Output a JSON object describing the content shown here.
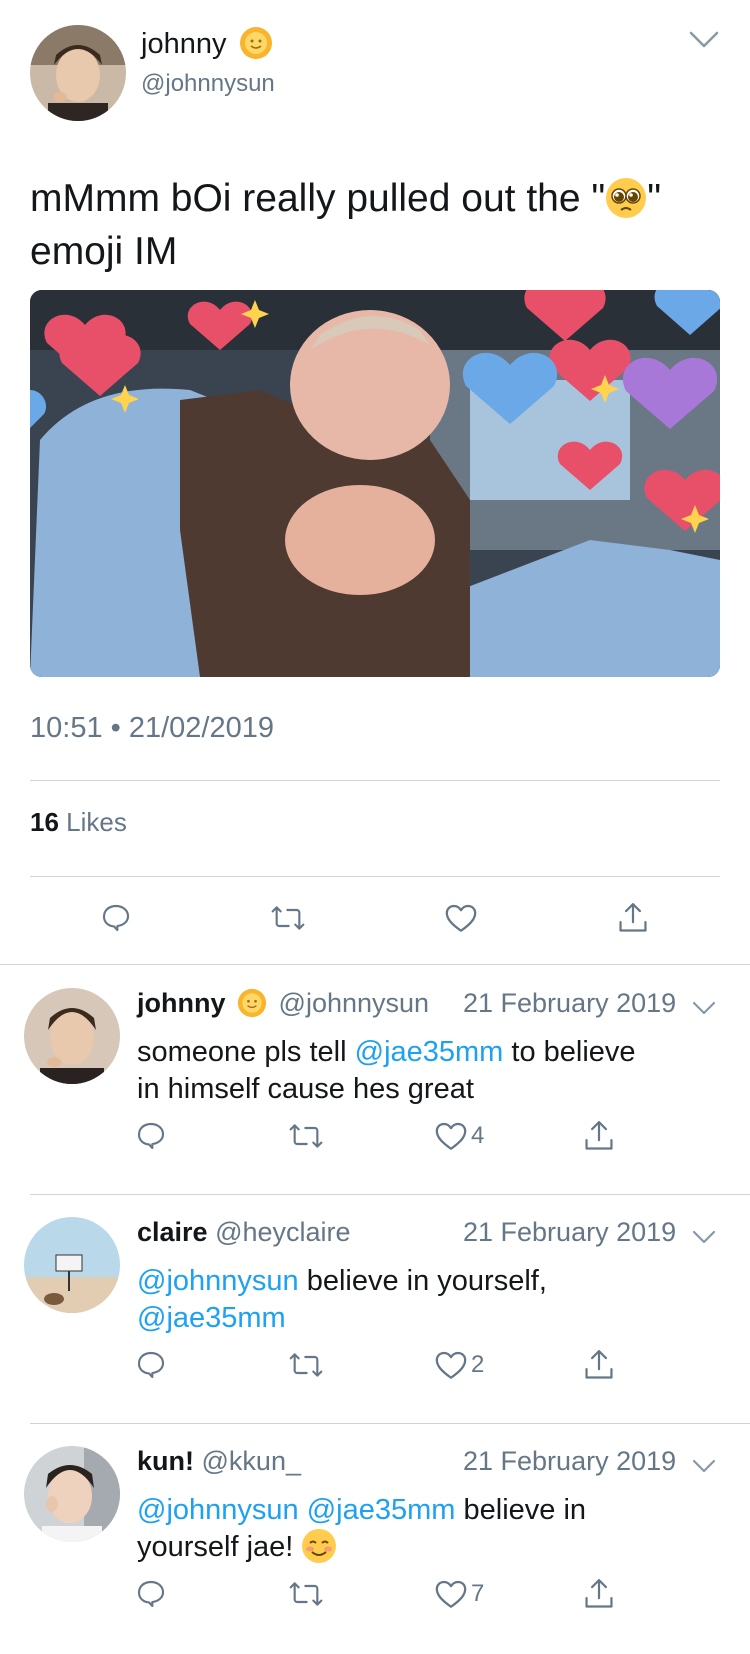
{
  "main_tweet": {
    "author_name": "johnny",
    "author_emoji": "sun-with-face",
    "handle": "@johnnysun",
    "text_before_emoji": "mMmm bOi really pulled out the \"",
    "text_emoji": "pleading-face",
    "text_after_emoji": "\"",
    "text_line2": "emoji IM",
    "media_alt": "man clutching chest with hearts",
    "timestamp": "10:51 • 21/02/2019",
    "likes_count": "16",
    "likes_label": "Likes"
  },
  "replies": [
    {
      "name": "johnny",
      "has_emoji": true,
      "handle": "@johnnysun",
      "date": "21 February 2019",
      "line1_parts": [
        {
          "text": "someone pls tell ",
          "link": false
        },
        {
          "text": "@jae35mm",
          "link": true
        },
        {
          "text": " to believe",
          "link": false
        }
      ],
      "line2": "in himself cause hes great",
      "like_count": "4"
    },
    {
      "name": "claire",
      "has_emoji": false,
      "handle": "@heyclaire",
      "date": "21 February 2019",
      "line1_parts": [
        {
          "text": "@johnnysun",
          "link": true
        },
        {
          "text": " believe in yourself,",
          "link": false
        }
      ],
      "line2_link": "@jae35mm",
      "like_count": "2"
    },
    {
      "name": "kun!",
      "has_emoji": false,
      "handle": "@kkun_",
      "date": "21 February 2019",
      "line1_parts": [
        {
          "text": "@johnnysun",
          "link": true
        },
        {
          "text": " ",
          "link": false
        },
        {
          "text": "@jae35mm",
          "link": true
        },
        {
          "text": " believe in",
          "link": false
        }
      ],
      "line2": "yourself jae! ",
      "line2_emoji": "smiling-face",
      "like_count": "7"
    }
  ],
  "colors": {
    "link": "#1da1f2",
    "muted": "#657786",
    "divider": "#ccd6dd",
    "text": "#14171a"
  }
}
